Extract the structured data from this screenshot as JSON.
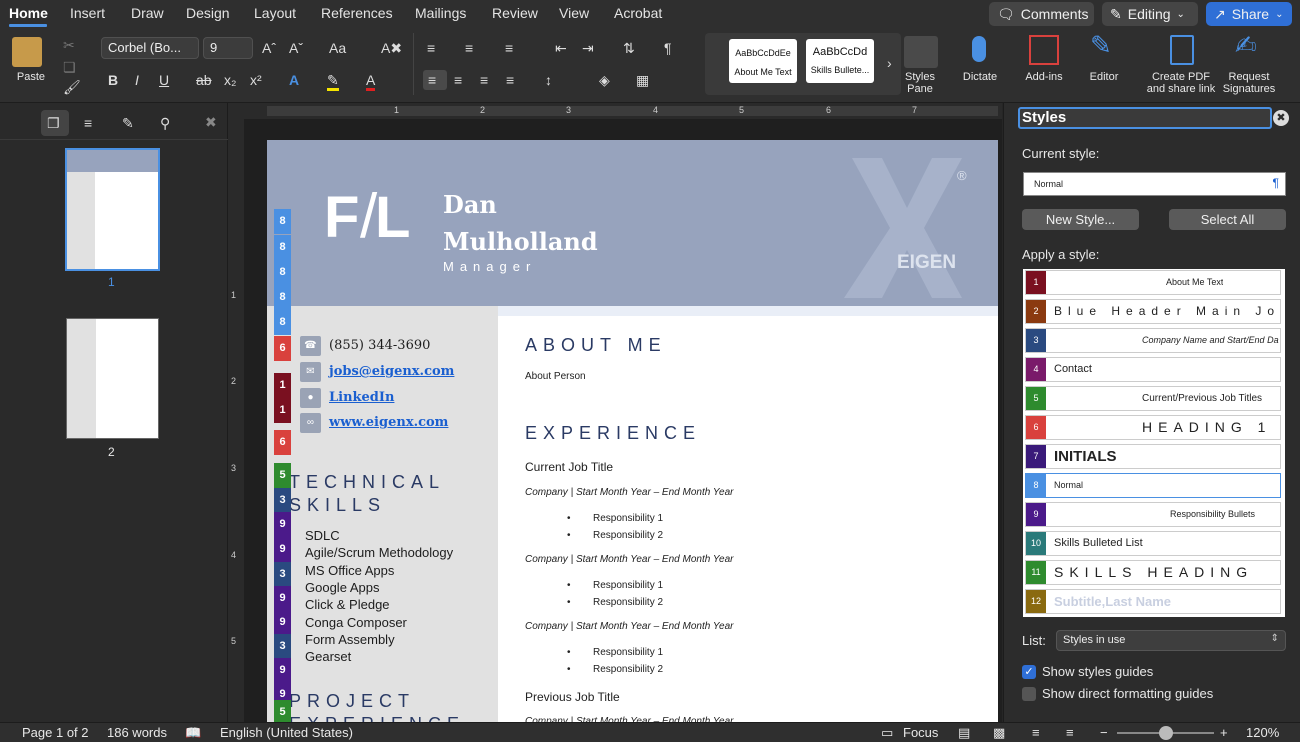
{
  "tabs": [
    "Home",
    "Insert",
    "Draw",
    "Design",
    "Layout",
    "References",
    "Mailings",
    "Review",
    "View",
    "Acrobat"
  ],
  "top_buttons": {
    "comments": "Comments",
    "editing": "Editing",
    "share": "Share"
  },
  "ribbon": {
    "paste": "Paste",
    "font_name": "Corbel (Bo...",
    "font_size": "9",
    "gallery": [
      {
        "preview": "AaBbCcDdEe",
        "label": "About Me Text"
      },
      {
        "preview": "AaBbCcDd",
        "label": "Skills Bullete..."
      }
    ],
    "styles_pane": "Styles\nPane",
    "dictate": "Dictate",
    "addins": "Add-ins",
    "editor": "Editor",
    "create_pdf": "Create PDF\nand share link",
    "request_sig": "Request\nSignatures"
  },
  "nav": {
    "thumb1_label": "1",
    "thumb2_label": "2"
  },
  "ruler": {
    "h": [
      "1",
      "2",
      "3",
      "4",
      "5",
      "6",
      "7"
    ],
    "v": [
      "1",
      "2",
      "3",
      "4",
      "5"
    ]
  },
  "document": {
    "initials_left": "F",
    "initials_right": "L",
    "first_name": "Dan",
    "last_name": "Mulholland",
    "job_title": "Manager",
    "logo_text": "EIGEN",
    "registered_mark": "®",
    "stripes": [
      {
        "n": "8",
        "color": "#4a90e2"
      },
      {
        "n": "8",
        "color": "#4a90e2"
      },
      {
        "n": "8",
        "color": "#4a90e2"
      },
      {
        "n": "8",
        "color": "#4a90e2"
      },
      {
        "n": "8",
        "color": "#4a90e2"
      },
      {
        "n": "6",
        "color": "#d9413d"
      },
      {
        "n": "1",
        "color": "#7a1020"
      },
      {
        "n": "1",
        "color": "#7a1020"
      },
      {
        "n": "6",
        "color": "#d9413d"
      },
      {
        "n": "5",
        "color": "#2e8b2e"
      },
      {
        "n": "3",
        "color": "#2a4a80"
      },
      {
        "n": "9",
        "color": "#4b1a8a"
      },
      {
        "n": "9",
        "color": "#4b1a8a"
      },
      {
        "n": "3",
        "color": "#2a4a80"
      },
      {
        "n": "9",
        "color": "#4b1a8a"
      },
      {
        "n": "9",
        "color": "#4b1a8a"
      },
      {
        "n": "3",
        "color": "#2a4a80"
      },
      {
        "n": "9",
        "color": "#4b1a8a"
      },
      {
        "n": "9",
        "color": "#4b1a8a"
      },
      {
        "n": "5",
        "color": "#2e8b2e"
      }
    ],
    "contact": {
      "phone": "(855) 344-3690",
      "email": "jobs@eigenx.com",
      "linkedin": "LinkedIn",
      "website": "www.eigenx.com"
    },
    "technical_skills_heading_1": "TECHNICAL",
    "technical_skills_heading_2": "SKILLS",
    "skills": [
      "SDLC",
      "Agile/Scrum Methodology",
      "MS Office Apps",
      "Google Apps",
      "Click & Pledge",
      "Conga Composer",
      "Form Assembly",
      "Gearset"
    ],
    "project_heading_1": "PROJECT",
    "project_heading_2": "EXPERIENCE",
    "about_heading": "ABOUT ME",
    "about_text": "About Person",
    "experience_heading": "EXPERIENCE",
    "current_job": "Current Job Title",
    "company_line": "Company | Start Month Year – End Month Year",
    "resp1": "Responsibility 1",
    "resp2": "Responsibility 2",
    "previous_job": "Previous Job Title"
  },
  "pane": {
    "title": "Styles",
    "current_style_label": "Current style:",
    "current_style": "Normal",
    "new_style": "New Style...",
    "select_all": "Select All",
    "apply_label": "Apply a style:",
    "styles": [
      {
        "n": "1",
        "name": "About Me Text",
        "color": "#7a1020"
      },
      {
        "n": "2",
        "name": "Blue Header Main Job",
        "color": "#8b3a10"
      },
      {
        "n": "3",
        "name": "Company Name and Start/End Da",
        "color": "#2a4a80"
      },
      {
        "n": "4",
        "name": "Contact",
        "color": "#7a1a6a"
      },
      {
        "n": "5",
        "name": "Current/Previous Job Titles",
        "color": "#2e8b2e"
      },
      {
        "n": "6",
        "name": "HEADING 1",
        "color": "#d9413d"
      },
      {
        "n": "7",
        "name": "INITIALS",
        "color": "#3a1a7a"
      },
      {
        "n": "8",
        "name": "Normal",
        "color": "#4a90e2"
      },
      {
        "n": "9",
        "name": "Responsibility Bullets",
        "color": "#4b1a8a"
      },
      {
        "n": "10",
        "name": "Skills Bulleted List",
        "color": "#2a7a7a"
      },
      {
        "n": "11",
        "name": "SKILLS HEADING",
        "color": "#2e8b2e"
      },
      {
        "n": "12",
        "name": "Subtitle,Last Name",
        "color": "#8a6a10"
      }
    ],
    "list_label": "List:",
    "list_value": "Styles in use",
    "show_guides": "Show styles guides",
    "show_direct": "Show direct formatting guides"
  },
  "status": {
    "page": "Page 1 of 2",
    "words": "186 words",
    "language": "English (United States)",
    "focus": "Focus",
    "zoom": "120%"
  }
}
